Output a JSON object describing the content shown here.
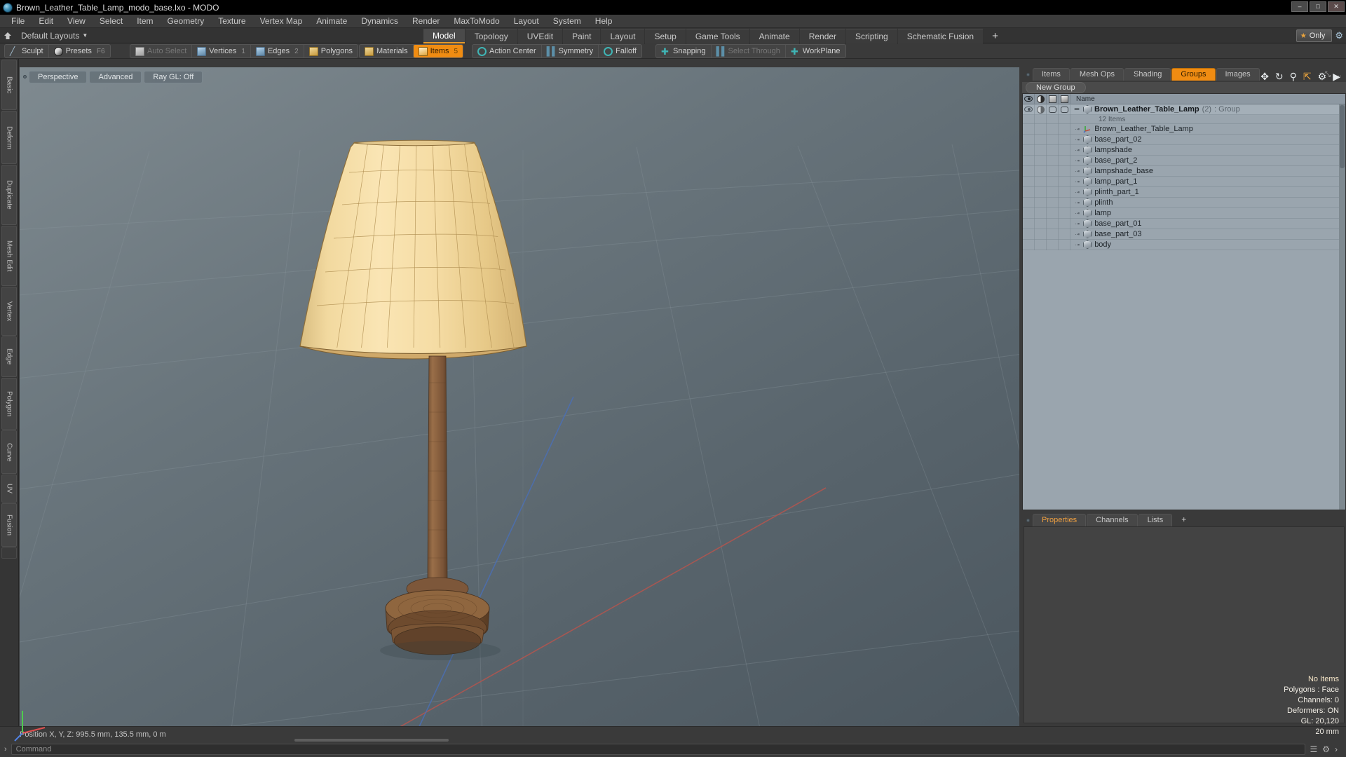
{
  "window": {
    "title": "Brown_Leather_Table_Lamp_modo_base.lxo - MODO",
    "minimize": "–",
    "maximize": "□",
    "close": "✕"
  },
  "menubar": {
    "items": [
      "File",
      "Edit",
      "View",
      "Select",
      "Item",
      "Geometry",
      "Texture",
      "Vertex Map",
      "Animate",
      "Dynamics",
      "Render",
      "MaxToModo",
      "Layout",
      "System",
      "Help"
    ]
  },
  "layoutbar": {
    "home_icon": "home-icon",
    "label": "Default Layouts",
    "caret": "▼",
    "tabs": [
      {
        "label": "Model",
        "active": true
      },
      {
        "label": "Topology",
        "active": false
      },
      {
        "label": "UVEdit",
        "active": false
      },
      {
        "label": "Paint",
        "active": false
      },
      {
        "label": "Layout",
        "active": false
      },
      {
        "label": "Setup",
        "active": false
      },
      {
        "label": "Game Tools",
        "active": false
      },
      {
        "label": "Animate",
        "active": false
      },
      {
        "label": "Render",
        "active": false
      },
      {
        "label": "Scripting",
        "active": false
      },
      {
        "label": "Schematic Fusion",
        "active": false
      }
    ],
    "add_tab": "+",
    "only_label": "Only",
    "star": "★",
    "gear": "⚙"
  },
  "modebar": {
    "group1": [
      {
        "label": "Sculpt",
        "icon": "pen-icon",
        "active": false,
        "dim": false,
        "num": ""
      },
      {
        "label": "Presets",
        "icon": "sphere-icon",
        "active": false,
        "dim": false,
        "num": "F6"
      }
    ],
    "group2": [
      {
        "label": "Auto Select",
        "icon": "cube-grey-icon",
        "active": false,
        "dim": true,
        "num": ""
      },
      {
        "label": "Vertices",
        "icon": "cube-blue-icon",
        "active": false,
        "dim": false,
        "num": "1"
      },
      {
        "label": "Edges",
        "icon": "cube-blue-icon",
        "active": false,
        "dim": false,
        "num": "2"
      },
      {
        "label": "Polygons",
        "icon": "cube-gold-icon",
        "active": false,
        "dim": false,
        "num": ""
      }
    ],
    "group3": [
      {
        "label": "Materials",
        "icon": "cube-gold-icon",
        "active": false,
        "dim": false,
        "num": ""
      },
      {
        "label": "Items",
        "icon": "cube-orange-icon",
        "active": true,
        "dim": false,
        "num": "5"
      }
    ],
    "group4": [
      {
        "label": "Action Center",
        "icon": "target-icon",
        "active": false,
        "dim": false,
        "num": ""
      },
      {
        "label": "Symmetry",
        "icon": "bars-icon",
        "active": false,
        "dim": false,
        "num": ""
      },
      {
        "label": "Falloff",
        "icon": "ring-icon",
        "active": false,
        "dim": false,
        "num": ""
      }
    ],
    "group5": [
      {
        "label": "Snapping",
        "icon": "cross-icon",
        "active": false,
        "dim": false,
        "num": ""
      },
      {
        "label": "Select Through",
        "icon": "bars-icon",
        "active": false,
        "dim": true,
        "num": ""
      },
      {
        "label": "WorkPlane",
        "icon": "cross-icon",
        "active": false,
        "dim": false,
        "num": ""
      }
    ]
  },
  "left_tabs": [
    "Basic",
    "Deform",
    "Duplicate",
    "Mesh Edit",
    "Vertex",
    "Edge",
    "Polygon",
    "Curve",
    "UV",
    "Fusion"
  ],
  "viewport": {
    "buttons": [
      {
        "label": "Perspective"
      },
      {
        "label": "Advanced"
      },
      {
        "label": "Ray GL: Off"
      }
    ],
    "tool_icons": [
      "move-icon",
      "rotate-icon",
      "zoom-icon",
      "fit-icon",
      "gear-icon",
      "play-icon"
    ],
    "stats": {
      "selection": "No Items",
      "polygons": "Polygons : Face",
      "channels": "Channels: 0",
      "deformers": "Deformers: ON",
      "gl": "GL: 20,120",
      "unit": "20 mm"
    }
  },
  "statusbar": {
    "position": "Position X, Y, Z:   995.5 mm, 135.5 mm, 0 m"
  },
  "commandbar": {
    "caret": "›",
    "placeholder": "Command",
    "icons": [
      "☰",
      "⚙",
      "›"
    ]
  },
  "right_panel": {
    "tabs": [
      {
        "label": "Items",
        "active": false
      },
      {
        "label": "Mesh Ops",
        "active": false
      },
      {
        "label": "Shading",
        "active": false
      },
      {
        "label": "Groups",
        "active": true
      },
      {
        "label": "Images",
        "active": false
      }
    ],
    "expand_icons": [
      "⤡",
      "…"
    ],
    "new_group_button": "New Group",
    "tree": {
      "columns": [
        "visibility-icon",
        "shading-icon",
        "render-icon",
        "wireframe-icon"
      ],
      "name_header": "Name",
      "group": {
        "name": "Brown_Leather_Table_Lamp",
        "count": "(2)",
        "type": ": Group",
        "subcount": "12 Items"
      },
      "rows": [
        {
          "name": "Brown_Leather_Table_Lamp",
          "icon": "locator-icon"
        },
        {
          "name": "base_part_02",
          "icon": "mesh-icon"
        },
        {
          "name": "lampshade",
          "icon": "mesh-icon"
        },
        {
          "name": "base_part_2",
          "icon": "mesh-icon"
        },
        {
          "name": "lampshade_base",
          "icon": "mesh-icon"
        },
        {
          "name": "lamp_part_1",
          "icon": "mesh-icon"
        },
        {
          "name": "plinth_part_1",
          "icon": "mesh-icon"
        },
        {
          "name": "plinth",
          "icon": "mesh-icon"
        },
        {
          "name": "lamp",
          "icon": "mesh-icon"
        },
        {
          "name": "base_part_01",
          "icon": "mesh-icon"
        },
        {
          "name": "base_part_03",
          "icon": "mesh-icon"
        },
        {
          "name": "body",
          "icon": "mesh-icon"
        }
      ]
    },
    "properties": {
      "tabs": [
        {
          "label": "Properties",
          "active": true
        },
        {
          "label": "Channels",
          "active": false
        },
        {
          "label": "Lists",
          "active": false
        },
        {
          "label": "+",
          "active": false
        }
      ]
    }
  },
  "colors": {
    "accent": "#f08c12",
    "panel": "#3a3a3a",
    "tree_bg": "#9aa5ae",
    "lamp_shade": "#f0d79a",
    "lamp_wood": "#8a6342"
  }
}
